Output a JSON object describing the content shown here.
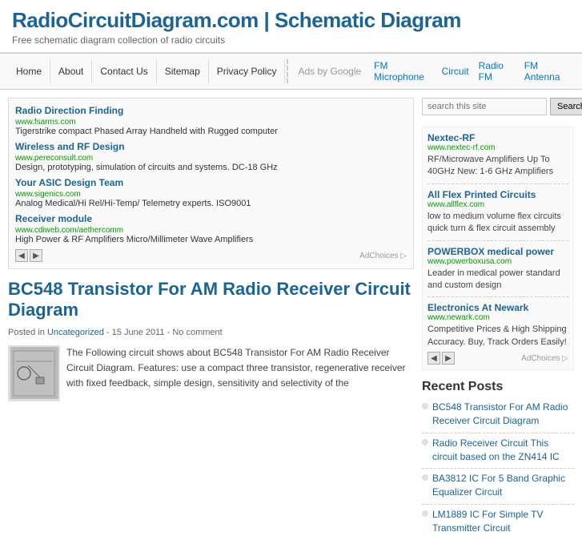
{
  "header": {
    "title": "RadioCircuitDiagram.com | Schematic Diagram",
    "subtitle": "Free schematic diagram collection of radio circuits"
  },
  "nav": {
    "items": [
      {
        "label": "Home",
        "active": false
      },
      {
        "label": "About",
        "active": false
      },
      {
        "label": "Contact Us",
        "active": false
      },
      {
        "label": "Sitemap",
        "active": false
      },
      {
        "label": "Privacy Policy",
        "active": false
      }
    ],
    "ads_label": "Ads by Google",
    "ad_links": [
      "FM Microphone",
      "Circuit",
      "Radio FM",
      "FM Antenna"
    ]
  },
  "main_ad": {
    "entries": [
      {
        "link": "Radio Direction Finding",
        "url": "www.fsarms.com",
        "desc": "Tigerstrike compact Phased Array Handheld with Rugged computer"
      },
      {
        "link": "Wireless and RF Design",
        "url": "www.pereconsult.com",
        "desc": "Design, prototyping, simulation of circuits and systems. DC-18 GHz"
      },
      {
        "link": "Your ASIC Design Team",
        "url": "www.sigenics.com",
        "desc": "Analog Medical/Hi Rel/Hi-Temp/ Telemetry experts. ISO9001"
      },
      {
        "link": "Receiver module",
        "url": "www.cdiweb.com/aethercomm",
        "desc": "High Power & RF Amplifiers Micro/Millimeter Wave Amplifiers"
      }
    ],
    "ad_choices": "AdChoices ▷"
  },
  "article": {
    "title": "BC548 Transistor For AM Radio Receiver Circuit Diagram",
    "meta_posted": "Posted in",
    "meta_category": "Uncategorized",
    "meta_date": "15 June 2011",
    "meta_comment": "No comment",
    "body": "The Following circuit shows about BC548 Transistor For AM Radio Receiver Circuit Diagram. Features: use a compact three transistor, regenerative receiver with fixed feedback, simple design, sensitivity and selectivity of the"
  },
  "sidebar": {
    "search_placeholder": "search this site",
    "search_button": "Search",
    "ads": [
      {
        "link": "Nextec-RF",
        "desc": "RF/Microwave Amplifiers Up To 40GHz New: 1-6 GHz Amplifiers",
        "url": "www.nextec-rf.com"
      },
      {
        "link": "All Flex Printed Circuits",
        "desc": "low to medium volume flex circuits quick turn & flex circuit assembly",
        "url": "www.allflex.com"
      },
      {
        "link": "POWERBOX medical power",
        "desc": "Leader in medical power standard and custom design",
        "url": "www.powerboxusa.com"
      },
      {
        "link": "Electronics At Newark",
        "desc": "Competitive Prices & High Shipping Accuracy. Buy, Track Orders Easily!",
        "url": "www.newark.com"
      }
    ],
    "ad_choices": "AdChoices ▷",
    "recent_posts_title": "Recent Posts",
    "recent_posts": [
      "BC548 Transistor For AM Radio Receiver Circuit Diagram",
      "Radio Receiver Circuit This circuit based on the ZN414 IC",
      "BA3812 IC For 5 Band Graphic Equalizer Circuit",
      "LM1889 IC For Simple TV Transmitter Circuit"
    ]
  }
}
